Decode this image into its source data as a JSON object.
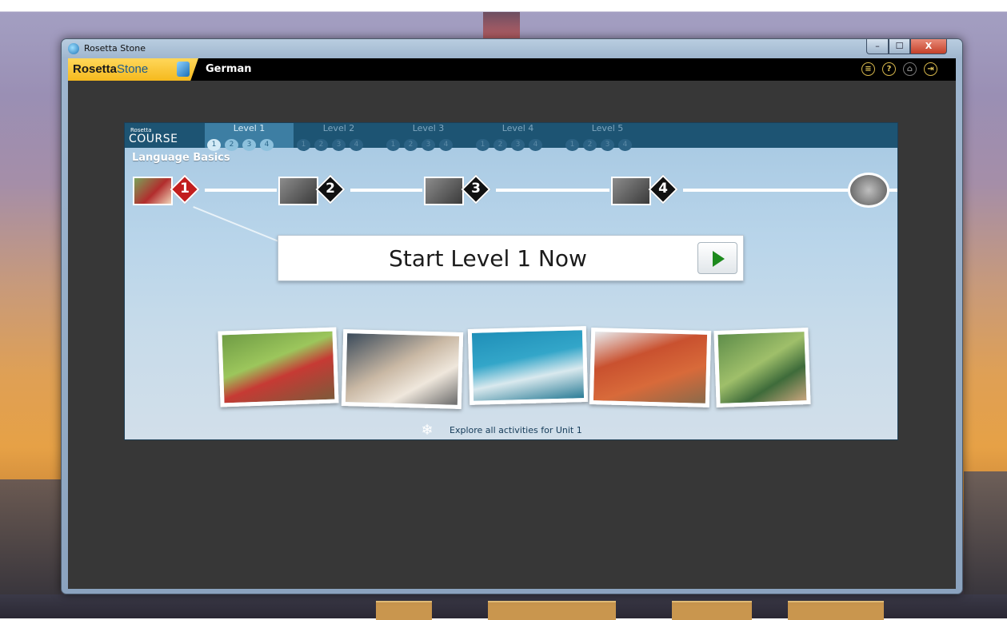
{
  "window": {
    "title": "Rosetta Stone",
    "controls": {
      "minimize": "–",
      "maximize": "☐",
      "close": "X"
    }
  },
  "appbar": {
    "logo_bold": "Rosetta",
    "logo_light": "Stone",
    "language": "German",
    "tools": [
      {
        "icon": "list-icon",
        "glyph": "≡"
      },
      {
        "icon": "help-icon",
        "glyph": "?"
      },
      {
        "icon": "home-icon",
        "glyph": "⌂"
      },
      {
        "icon": "exit-icon",
        "glyph": "⇥"
      }
    ]
  },
  "course": {
    "brand_small": "Rosetta",
    "brand_main": "COURSE",
    "levels": [
      {
        "label": "Level 1",
        "units": [
          "1",
          "2",
          "3",
          "4"
        ],
        "active": true
      },
      {
        "label": "Level 2",
        "units": [
          "1",
          "2",
          "3",
          "4"
        ],
        "active": false
      },
      {
        "label": "Level 3",
        "units": [
          "1",
          "2",
          "3",
          "4"
        ],
        "active": false
      },
      {
        "label": "Level 4",
        "units": [
          "1",
          "2",
          "3",
          "4"
        ],
        "active": false
      },
      {
        "label": "Level 5",
        "units": [
          "1",
          "2",
          "3",
          "4"
        ],
        "active": false
      }
    ],
    "section_title": "Language Basics",
    "units": [
      "1",
      "2",
      "3",
      "4"
    ],
    "start_label": "Start Level 1 Now",
    "explore_label": "Explore all activities for Unit 1"
  },
  "colors": {
    "accent_gold": "#f5b91d",
    "course_header": "#1d5473",
    "play_green": "#1d8a1d",
    "unit1_red": "#c21e1e"
  }
}
